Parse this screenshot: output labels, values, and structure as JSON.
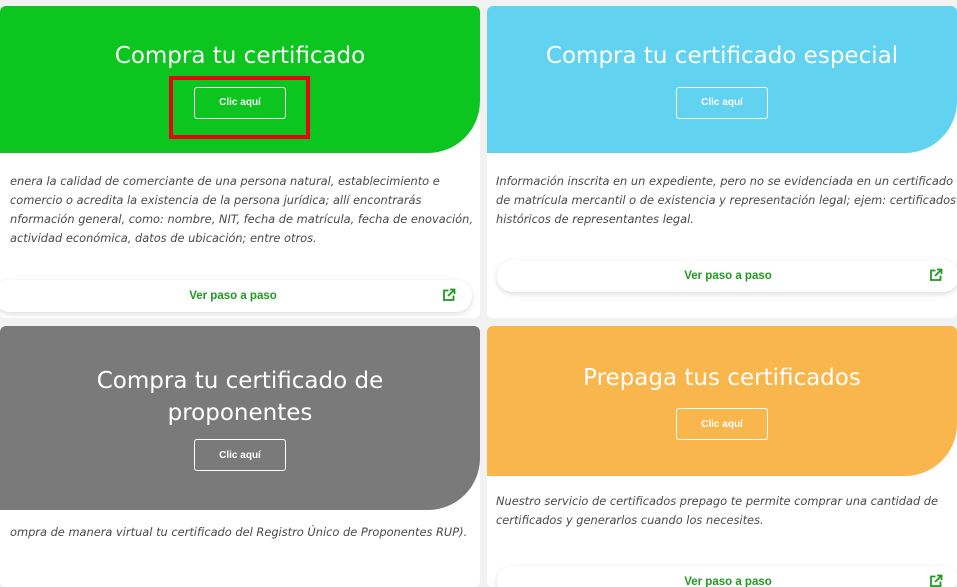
{
  "colors": {
    "green": "#0cc61f",
    "blue": "#61d2f0",
    "gray": "#7a7a7a",
    "orange": "#f8b64c",
    "link_green": "#1f9a1f",
    "highlight_red": "#e30613"
  },
  "cards": [
    {
      "title": "Compra tu certificado",
      "button": "Clic aquí",
      "description": "enera la calidad de comerciante de una persona natural, establecimiento e comercio o acredita la existencia de la persona jurídica; allí encontrarás nformación general, como: nombre, NIT, fecha de matrícula, fecha de enovación, actividad económica, datos de ubicación; entre otros.",
      "step_label": "Ver paso a paso"
    },
    {
      "title": "Compra tu certificado especial",
      "button": "Clic aquí",
      "description": "Información inscrita en un expediente, pero no se evidenciada en un certificado de matrícula mercantil o de existencia y representación legal; ejem: certificados históricos de representantes legal.",
      "step_label": "Ver paso a paso"
    },
    {
      "title": "Compra tu certificado de proponentes",
      "button": "Clic aquí",
      "description": "ompra de manera virtual tu certificado del Registro Único de Proponentes RUP)."
    },
    {
      "title": "Prepaga tus certificados",
      "button": "Clic aquí",
      "description": "Nuestro servicio de certificados prepago te permite comprar una cantidad de certificados y generarlos cuando los necesites.",
      "step_label": "Ver paso a paso"
    }
  ],
  "icons": {
    "step_icon": "external-link-icon"
  }
}
